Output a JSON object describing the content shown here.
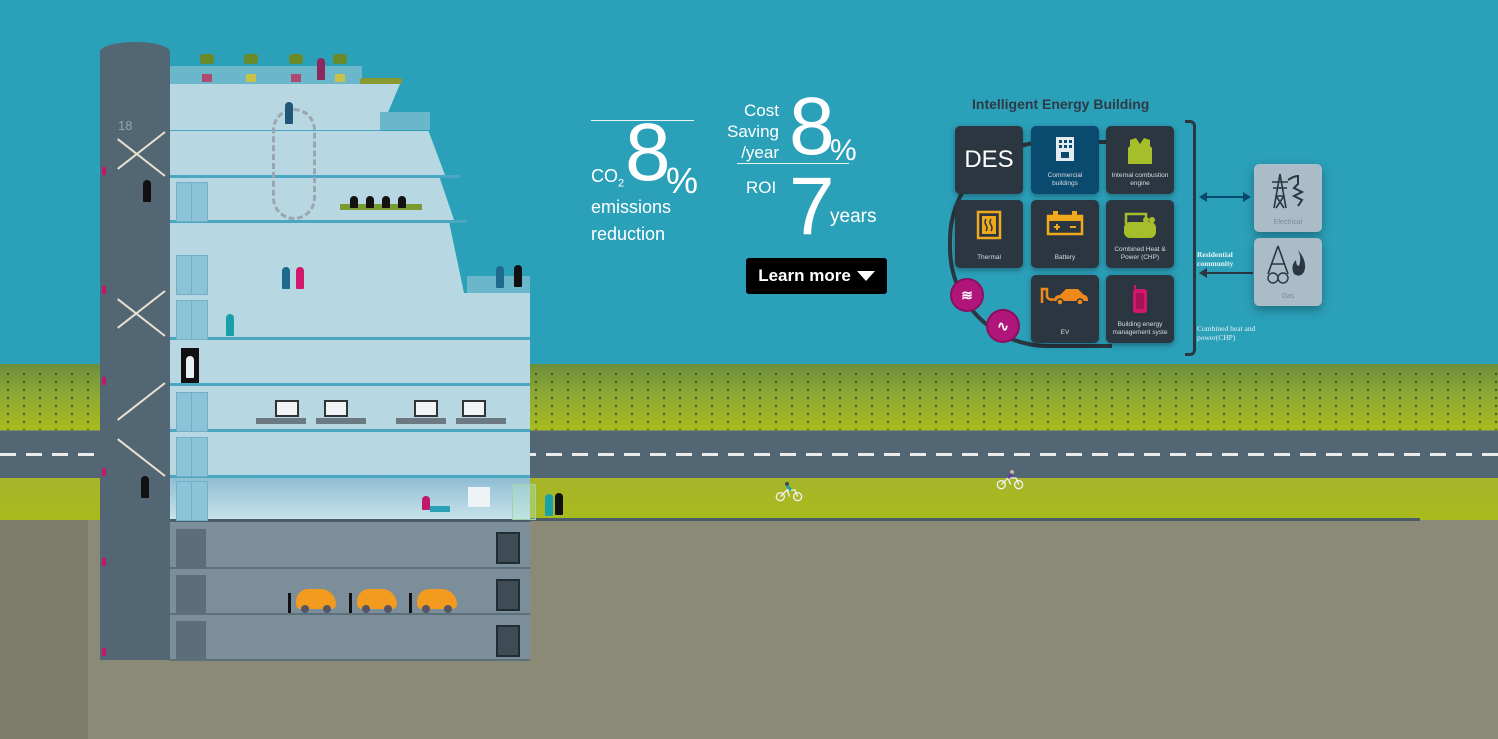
{
  "scene": {
    "tower_floor_number": "18",
    "colors": {
      "sky": "#2ba0b9",
      "road": "#536674",
      "grass": "#a8bb1c",
      "soil": "#8b8a76",
      "building_glass": "#b7d8e2",
      "basement": "#7b8e9a",
      "accent_magenta": "#b0167a"
    }
  },
  "stats": {
    "co2": {
      "label": "CO",
      "label_sub": "2",
      "value": "8",
      "unit": "%",
      "desc_line1": "emissions",
      "desc_line2": "reduction"
    },
    "cost": {
      "label_line1": "Cost",
      "label_line2": "Saving",
      "label_line3": "/year",
      "value": "8",
      "unit": "%"
    },
    "roi": {
      "label": "ROI",
      "value": "7",
      "unit": "years"
    },
    "learn_more": {
      "label": "Learn more",
      "icon": "caret-down-icon"
    }
  },
  "diagram": {
    "title": "Intelligent Energy Building",
    "tiles": [
      {
        "id": "des",
        "label": "DES",
        "icon": ""
      },
      {
        "id": "commercial",
        "label": "Commercial buildings",
        "icon": "office-building-icon"
      },
      {
        "id": "ice",
        "label": "Internal combustion engine",
        "icon": "engine-icon"
      },
      {
        "id": "thermal",
        "label": "Thermal",
        "icon": "heat-icon"
      },
      {
        "id": "battery",
        "label": "Battery",
        "icon": "battery-icon"
      },
      {
        "id": "chp",
        "label": "Combined Heat & Power (CHP)",
        "icon": "chp-unit-icon"
      },
      {
        "id": "ev",
        "label": "EV",
        "icon": "ev-charging-icon"
      },
      {
        "id": "bems",
        "label": "Building energy management syste",
        "icon": "mobile-device-icon"
      }
    ],
    "badges": [
      {
        "icon": "heat-waves-icon",
        "glyph": "≋"
      },
      {
        "icon": "electric-wave-icon",
        "glyph": "∿"
      }
    ],
    "grid": [
      {
        "label": "Electrical",
        "icon": "power-pylon-icon"
      },
      {
        "label": "Gas",
        "icon": "gas-flame-icon"
      }
    ],
    "notes": {
      "residential": "Residential community",
      "chp": "Combined heat and power(CHP)"
    }
  }
}
